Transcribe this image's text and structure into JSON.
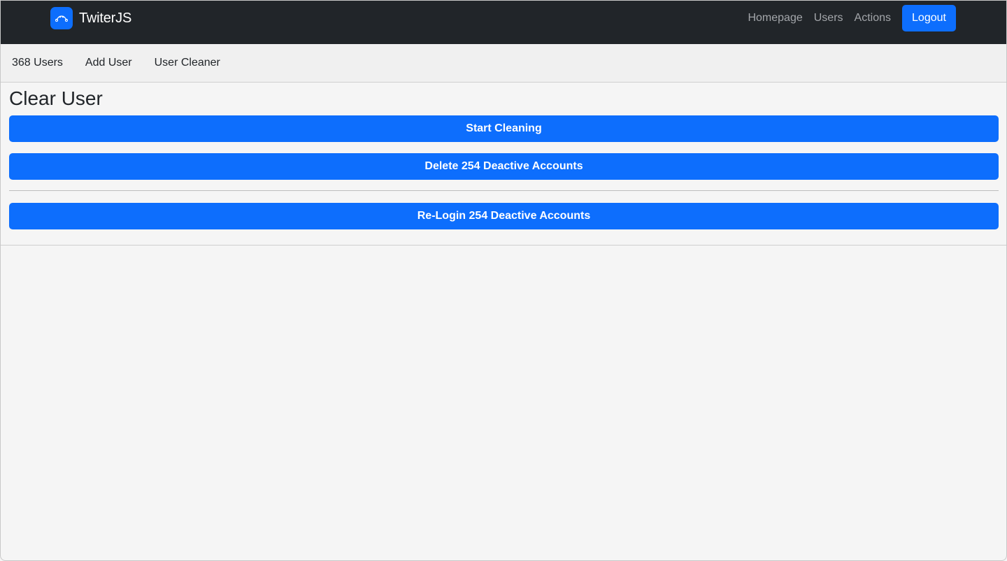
{
  "navbar": {
    "brand": "TwiterJS",
    "brand_icon": "bezier-curve-icon",
    "links": [
      {
        "label": "Homepage"
      },
      {
        "label": "Users"
      },
      {
        "label": "Actions"
      }
    ],
    "logout_label": "Logout"
  },
  "subnav": {
    "items": [
      {
        "label": "368 Users"
      },
      {
        "label": "Add User"
      },
      {
        "label": "User Cleaner"
      }
    ]
  },
  "main": {
    "title": "Clear User",
    "start_label": "Start Cleaning",
    "delete_label": "Delete 254 Deactive Accounts",
    "relogin_label": "Re-Login 254 Deactive Accounts"
  },
  "colors": {
    "navbar_bg": "#212529",
    "accent": "#0d6efd",
    "page_bg": "#f5f5f5"
  }
}
